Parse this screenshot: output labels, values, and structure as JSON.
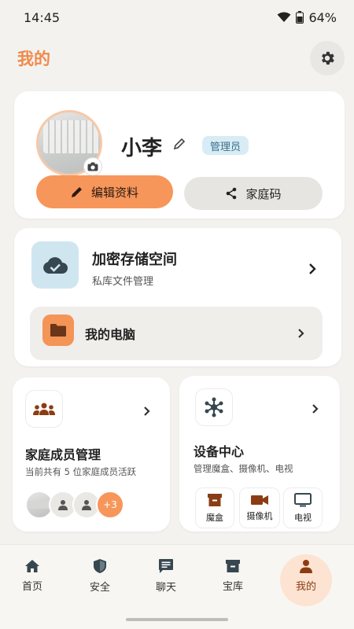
{
  "status_bar": {
    "time": "14:45",
    "battery": "64%"
  },
  "header": {
    "title": "我的",
    "settings_icon": "gear-icon"
  },
  "profile": {
    "name": "小李",
    "role_badge": "管理员",
    "edit_profile_label": "编辑资料",
    "family_code_label": "家庭码"
  },
  "storage": {
    "title": "加密存储空间",
    "subtitle": "私库文件管理",
    "pc_label": "我的电脑"
  },
  "family": {
    "title": "家庭成员管理",
    "subtitle": "当前共有 5 位家庭成员活跃",
    "more_count": "+3"
  },
  "devices": {
    "title": "设备中心",
    "subtitle": "管理魔盒、摄像机、电视",
    "items": [
      {
        "label": "魔盒",
        "icon": "box-icon"
      },
      {
        "label": "摄像机",
        "icon": "video-camera-icon"
      },
      {
        "label": "电视",
        "icon": "tv-icon"
      }
    ]
  },
  "nav": {
    "items": [
      {
        "label": "首页",
        "icon": "home-icon"
      },
      {
        "label": "安全",
        "icon": "shield-icon"
      },
      {
        "label": "聊天",
        "icon": "chat-icon"
      },
      {
        "label": "宝库",
        "icon": "archive-icon"
      },
      {
        "label": "我的",
        "icon": "person-icon",
        "active": true
      }
    ]
  },
  "colors": {
    "accent": "#f08a4b",
    "button_orange": "#f7965a",
    "active_nav_bg": "#fde3d1"
  }
}
